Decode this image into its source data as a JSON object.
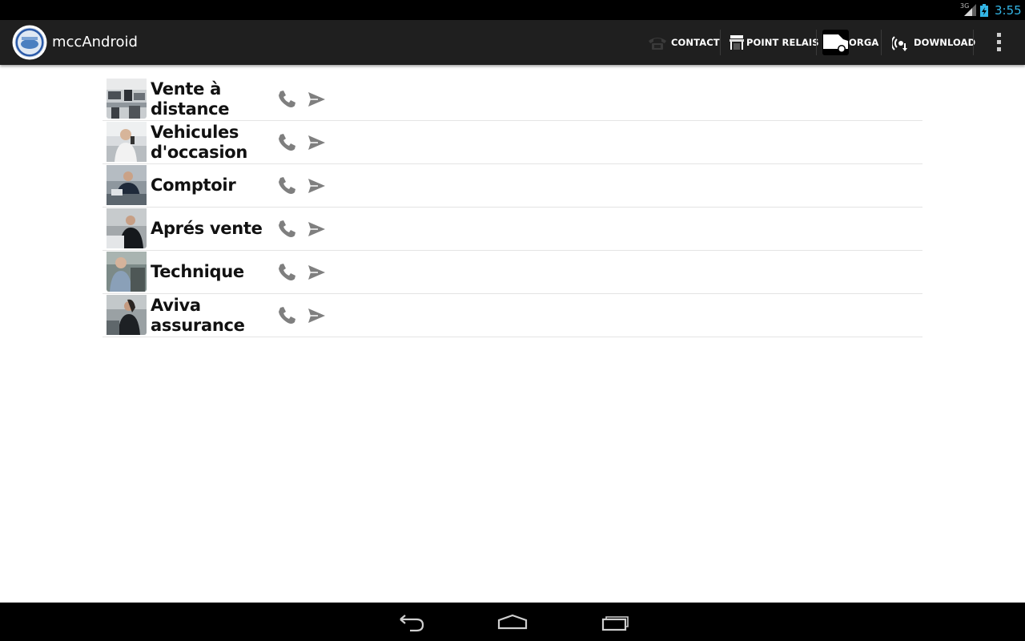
{
  "status_bar": {
    "network": "3G",
    "time": "3:55"
  },
  "action_bar": {
    "app_title": "mccAndroid",
    "actions": [
      {
        "label": "CONTACT",
        "icon": "phone-handset-icon"
      },
      {
        "label": "POINT RELAIS",
        "icon": "storefront-icon"
      },
      {
        "label": "ORGA",
        "icon": "van-icon"
      },
      {
        "label": "DOWNLOAD",
        "icon": "download-wifi-icon"
      }
    ],
    "overflow_icon": "overflow-menu-icon"
  },
  "contacts": [
    {
      "name": "Vente à distance",
      "photo_icon": "office-photo"
    },
    {
      "name": "Vehicules d'occasion",
      "photo_icon": "person-photo"
    },
    {
      "name": "Comptoir",
      "photo_icon": "person-photo"
    },
    {
      "name": "Aprés vente",
      "photo_icon": "person-photo"
    },
    {
      "name": "Technique",
      "photo_icon": "person-photo"
    },
    {
      "name": "Aviva assurance",
      "photo_icon": "person-photo"
    }
  ],
  "row_actions": {
    "call_icon": "phone-icon",
    "send_icon": "send-icon"
  },
  "nav_bar": [
    "back-icon",
    "home-icon",
    "recent-apps-icon"
  ],
  "colors": {
    "status_bar_bg": "#000000",
    "action_bar_bg": "#1f1f1f",
    "clock": "#33b5e5",
    "content_bg": "#ffffff",
    "row_icon": "#7f7f7f"
  }
}
